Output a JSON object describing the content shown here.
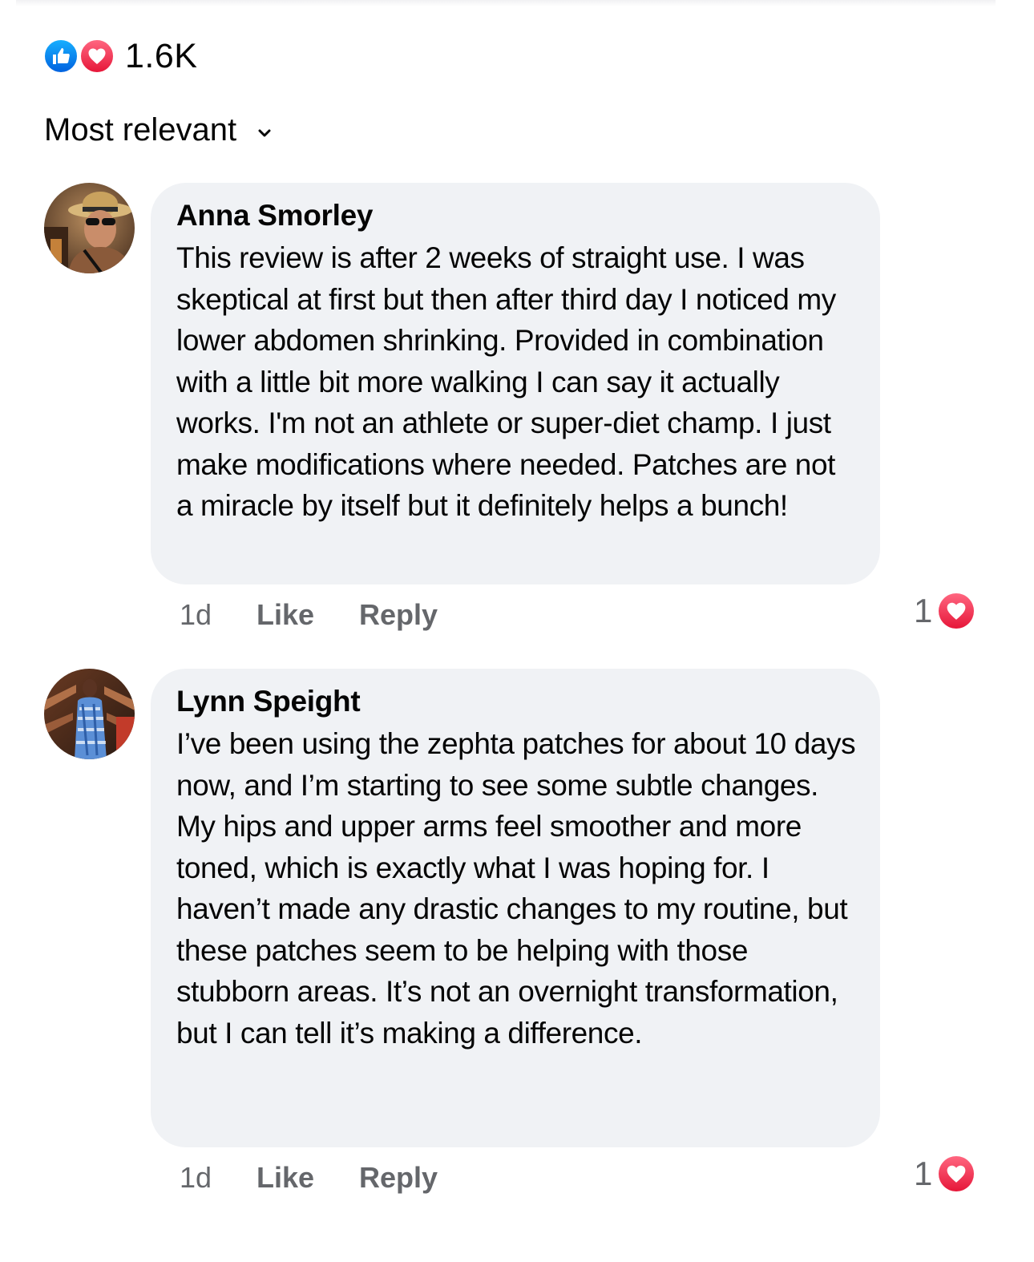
{
  "reactions": {
    "icons": [
      "like-icon",
      "love-icon"
    ],
    "count": "1.6K"
  },
  "sort": {
    "label": "Most relevant",
    "icon": "chevron-down-icon"
  },
  "comments": [
    {
      "author": "Anna Smorley",
      "text": "This review is after 2 weeks of straight use. I was skeptical at first but then after third day I noticed my lower abdomen shrinking. Provided in combination with a little bit more walking I can say it actually works. I'm not an athlete or super-diet champ. I just make modifications where needed. Patches are not a miracle by itself but it definitely helps a bunch!",
      "time": "1d",
      "like_label": "Like",
      "reply_label": "Reply",
      "reaction_count": "1",
      "reaction_icon": "love-icon"
    },
    {
      "author": "Lynn Speight",
      "text": "I’ve been using the zephta patches for about 10 days now, and I’m starting to see some subtle changes. My hips and upper arms feel smoother and more toned, which is exactly what I was hoping for. I haven’t made any drastic changes to my routine, but these patches seem to be helping with those stubborn areas. It’s not an overnight transformation, but I can tell it’s making a difference.",
      "time": "1d",
      "like_label": "Like",
      "reply_label": "Reply",
      "reaction_count": "1",
      "reaction_icon": "love-icon"
    }
  ],
  "colors": {
    "like_blue": "#0866ff",
    "love_red": "#f33e58",
    "bubble_bg": "#f0f2f5",
    "secondary_text": "#65676b"
  }
}
